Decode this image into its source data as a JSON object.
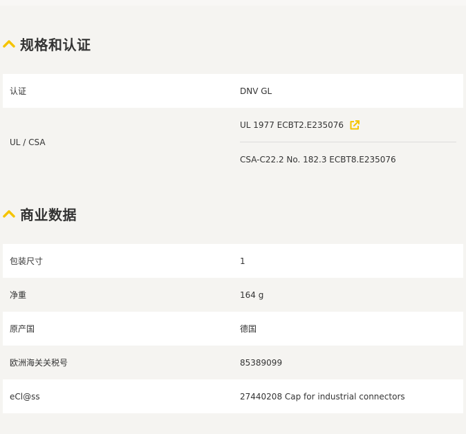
{
  "colors": {
    "accent": "#f5c400",
    "page_bg": "#f5f4f1",
    "row_white": "#ffffff",
    "text": "#333333"
  },
  "specs": {
    "title": "规格和认证",
    "icon": "chevron-up-icon",
    "rows": [
      {
        "label": "认证",
        "value": "DNV GL"
      },
      {
        "label": "UL / CSA",
        "values": [
          "UL 1977 ECBT2.E235076",
          "CSA-C22.2 No. 182.3 ECBT8.E235076"
        ],
        "link_icon": "external-link-icon"
      }
    ]
  },
  "commercial": {
    "title": "商业数据",
    "icon": "chevron-up-icon",
    "rows": [
      {
        "label": "包装尺寸",
        "value": "1"
      },
      {
        "label": "净重",
        "value": "164 g"
      },
      {
        "label": "原产国",
        "value": "德国"
      },
      {
        "label": "欧洲海关关税号",
        "value": "85389099"
      },
      {
        "label": "eCl@ss",
        "value": "27440208 Cap for industrial connectors"
      }
    ]
  }
}
